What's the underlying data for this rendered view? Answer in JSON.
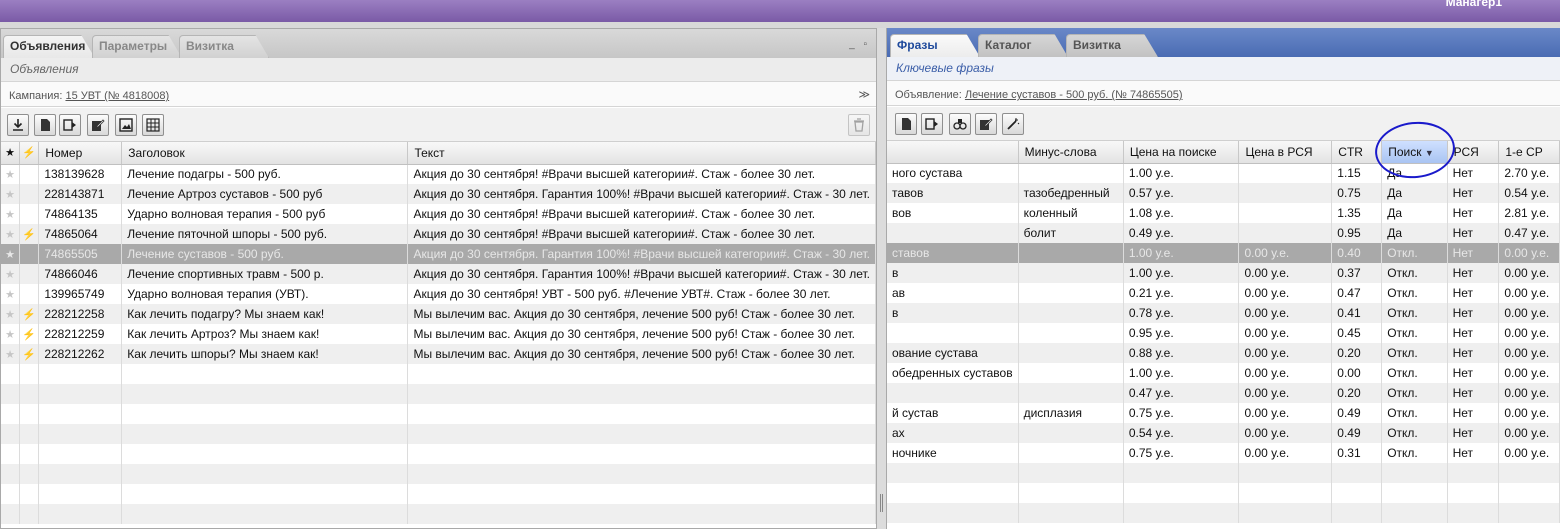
{
  "header": {
    "user": "Манагер1"
  },
  "left": {
    "tabs": [
      {
        "label": "Объявления"
      },
      {
        "label": "Параметры"
      },
      {
        "label": "Визитка"
      }
    ],
    "subtitle": "Объявления",
    "campaign_label": "Кампания:",
    "campaign_link": "15 УВТ (№ 4818008)",
    "columns": [
      "Номер",
      "Заголовок",
      "Текст"
    ],
    "rows": [
      {
        "id": "138139628",
        "title": "Лечение подагры - 500 руб.",
        "text": "Акция до 30 сентября! #Врачи высшей категории#. Стаж - более 30 лет.",
        "flag": "star"
      },
      {
        "id": "228143871",
        "title": "Лечение Артроз суставов - 500 руб",
        "text": "Акция до 30 сентября. Гарантия 100%! #Врачи высшей категории#. Стаж - 30 лет.",
        "flag": "star"
      },
      {
        "id": "74864135",
        "title": "Ударно волновая терапия - 500 руб",
        "text": "Акция до 30 сентября! #Врачи высшей категории#. Стаж - более 30 лет.",
        "flag": "star"
      },
      {
        "id": "74865064",
        "title": "Лечение пяточной шпоры - 500 руб.",
        "text": "Акция до 30 сентября! #Врачи высшей категории#. Стаж - более 30 лет.",
        "flag": "bolt"
      },
      {
        "id": "74865505",
        "title": "Лечение суставов - 500 руб.",
        "text": "Акция до 30 сентября. Гарантия 100%! #Врачи высшей категории#. Стаж - 30 лет.",
        "flag": "star"
      },
      {
        "id": "74866046",
        "title": "Лечение спортивных травм - 500 р.",
        "text": "Акция до 30 сентября. Гарантия 100%! #Врачи высшей категории#. Стаж - 30 лет.",
        "flag": "star"
      },
      {
        "id": "139965749",
        "title": "Ударно волновая терапия (УВТ).",
        "text": "Акция до 30 сентября! УВТ - 500 руб. #Лечение УВТ#. Стаж - более 30 лет.",
        "flag": "star"
      },
      {
        "id": "228212258",
        "title": "Как лечить подагру? Мы знаем как!",
        "text": "Мы вылечим вас. Акция до 30 сентября, лечение 500 руб! Стаж - более 30 лет.",
        "flag": "bolt"
      },
      {
        "id": "228212259",
        "title": "Как лечить Артроз? Мы знаем как!",
        "text": "Мы вылечим вас. Акция до 30 сентября, лечение 500 руб! Стаж - более 30 лет.",
        "flag": "bolt"
      },
      {
        "id": "228212262",
        "title": "Как лечить шпоры? Мы знаем как!",
        "text": "Мы вылечим вас. Акция до 30 сентября, лечение 500 руб! Стаж - более 30 лет.",
        "flag": "bolt"
      }
    ]
  },
  "right": {
    "tabs": [
      {
        "label": "Фразы"
      },
      {
        "label": "Каталог"
      },
      {
        "label": "Визитка"
      }
    ],
    "subtitle": "Ключевые фразы",
    "ad_label": "Объявление:",
    "ad_link": "Лечение суставов - 500 руб. (№ 74865505)",
    "columns": [
      "",
      "Минус-слова",
      "Цена на поиске",
      "Цена в РСЯ",
      "CTR",
      "Поиск",
      "РСЯ",
      "1-е СР"
    ],
    "rows": [
      [
        "ного сустава",
        "",
        "1.00 у.е.",
        "",
        "1.15",
        "Да",
        "Нет",
        "2.70 у.е."
      ],
      [
        "тавов",
        "тазобедренный",
        "0.57 у.е.",
        "",
        "0.75",
        "Да",
        "Нет",
        "0.54 у.е."
      ],
      [
        "вов",
        "коленный",
        "1.08 у.е.",
        "",
        "1.35",
        "Да",
        "Нет",
        "2.81 у.е."
      ],
      [
        "",
        "болит",
        "0.49 у.е.",
        "",
        "0.95",
        "Да",
        "Нет",
        "0.47 у.е."
      ],
      [
        "ставов",
        "",
        "1.00 у.е.",
        "0.00 у.е.",
        "0.40",
        "Откл.",
        "Нет",
        "0.00 у.е."
      ],
      [
        "в",
        "",
        "1.00 у.е.",
        "0.00 у.е.",
        "0.37",
        "Откл.",
        "Нет",
        "0.00 у.е."
      ],
      [
        "ав",
        "",
        "0.21 у.е.",
        "0.00 у.е.",
        "0.47",
        "Откл.",
        "Нет",
        "0.00 у.е."
      ],
      [
        "в",
        "",
        "0.78 у.е.",
        "0.00 у.е.",
        "0.41",
        "Откл.",
        "Нет",
        "0.00 у.е."
      ],
      [
        "",
        "",
        "0.95 у.е.",
        "0.00 у.е.",
        "0.45",
        "Откл.",
        "Нет",
        "0.00 у.е."
      ],
      [
        "ование сустава",
        "",
        "0.88 у.е.",
        "0.00 у.е.",
        "0.20",
        "Откл.",
        "Нет",
        "0.00 у.е."
      ],
      [
        "обедренных суставов",
        "",
        "1.00 у.е.",
        "0.00 у.е.",
        "0.00",
        "Откл.",
        "Нет",
        "0.00 у.е."
      ],
      [
        "",
        "",
        "0.47 у.е.",
        "0.00 у.е.",
        "0.20",
        "Откл.",
        "Нет",
        "0.00 у.е."
      ],
      [
        "й сустав",
        "дисплазия",
        "0.75 у.е.",
        "0.00 у.е.",
        "0.49",
        "Откл.",
        "Нет",
        "0.00 у.е."
      ],
      [
        "ах",
        "",
        "0.54 у.е.",
        "0.00 у.е.",
        "0.49",
        "Откл.",
        "Нет",
        "0.00 у.е."
      ],
      [
        "ночнике",
        "",
        "0.75 у.е.",
        "0.00 у.е.",
        "0.31",
        "Откл.",
        "Нет",
        "0.00 у.е."
      ]
    ]
  },
  "colors": {
    "selected_row": "#a9a9a9",
    "right_tabbar": "#4a6cb3",
    "annotation_circle": "#1a1acb"
  },
  "icons": {
    "left_toolbar": [
      "download-icon",
      "new-document-icon",
      "play-document-icon",
      "edit-icon",
      "image-icon",
      "table-icon"
    ],
    "right_toolbar": [
      "new-document-icon",
      "play-document-icon",
      "tools-icon",
      "edit-icon",
      "magic-wand-icon"
    ]
  }
}
